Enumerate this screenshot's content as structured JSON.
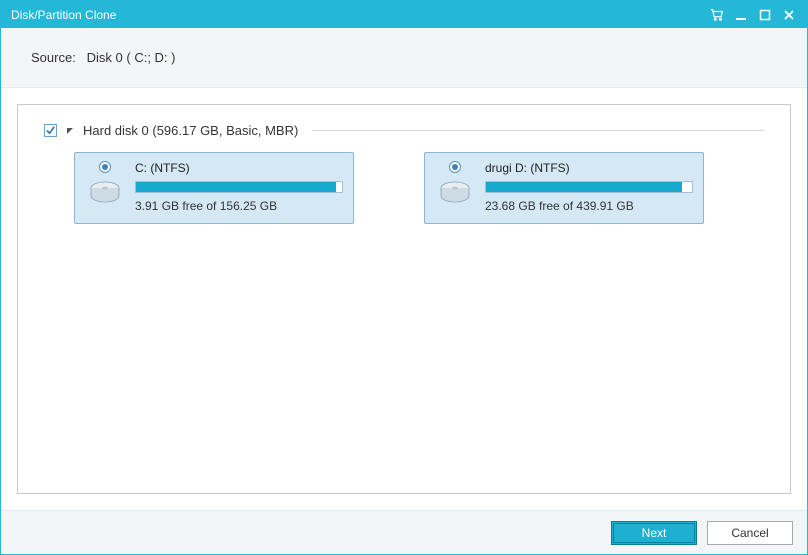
{
  "window": {
    "title": "Disk/Partition Clone"
  },
  "source": {
    "label": "Source:",
    "value": "Disk 0 ( C:; D: )"
  },
  "disk": {
    "checked": true,
    "label": "Hard disk 0 (596.17 GB, Basic, MBR)",
    "partitions": [
      {
        "selected": true,
        "title": "C: (NTFS)",
        "free_text": "3.91 GB free of 156.25 GB",
        "used_pct": 97
      },
      {
        "selected": true,
        "title": "drugi D: (NTFS)",
        "free_text": "23.68 GB free of 439.91 GB",
        "used_pct": 95
      }
    ]
  },
  "footer": {
    "next": "Next",
    "cancel": "Cancel"
  }
}
